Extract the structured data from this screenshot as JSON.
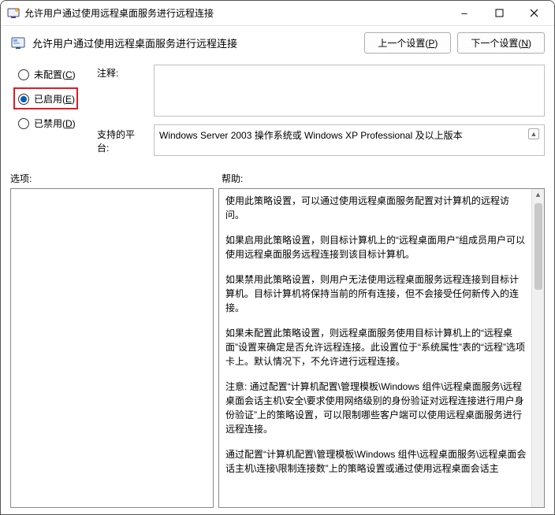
{
  "window": {
    "title": "允许用户通过使用远程桌面服务进行远程连接"
  },
  "header": {
    "title": "允许用户通过使用远程桌面服务进行远程连接",
    "prev_label": "上一个设置(",
    "prev_key": "P",
    "next_label": "下一个设置(",
    "next_key": "N",
    "close_paren": ")"
  },
  "labels": {
    "comment": "注释:",
    "platform": "支持的平台:",
    "options": "选项:",
    "help": "帮助:"
  },
  "radios": {
    "not_configured": "未配置(",
    "not_configured_key": "C",
    "enabled": "已启用(",
    "enabled_key": "E",
    "disabled": "已禁用(",
    "disabled_key": "D",
    "close_paren": ")"
  },
  "platform_text": "Windows Server 2003 操作系统或 Windows XP Professional 及以上版本",
  "help": {
    "p1": "使用此策略设置，可以通过使用远程桌面服务配置对计算机的远程访问。",
    "p2": "如果启用此策略设置，则目标计算机上的“远程桌面用户”组成员用户可以使用远程桌面服务远程连接到该目标计算机。",
    "p3": "如果禁用此策略设置，则用户无法使用远程桌面服务远程连接到目标计算机。目标计算机将保持当前的所有连接，但不会接受任何新传入的连接。",
    "p4": "如果未配置此策略设置，则远程桌面服务使用目标计算机上的“远程桌面”设置来确定是否允许远程连接。此设置位于“系统属性”表的“远程”选项卡上。默认情况下，不允许进行远程连接。",
    "p5": "注意: 通过配置“计算机配置\\管理模板\\Windows 组件\\远程桌面服务\\远程桌面会话主机\\安全\\要求使用网络级别的身份验证对远程连接进行用户身份验证”上的策略设置，可以限制哪些客户端可以使用远程桌面服务进行远程连接。",
    "p6": "通过配置“计算机配置\\管理模板\\Windows 组件\\远程桌面服务\\远程桌面会话主机\\连接\\限制连接数”上的策略设置或通过使用远程桌面会话主"
  }
}
